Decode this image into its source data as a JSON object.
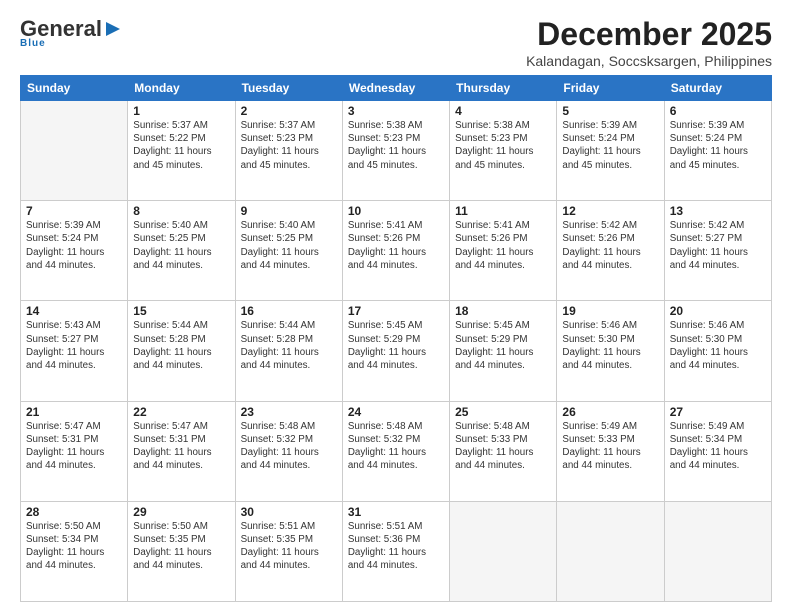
{
  "header": {
    "logo_general": "General",
    "logo_blue": "Blue",
    "month": "December 2025",
    "location": "Kalandagan, Soccsksargen, Philippines"
  },
  "days_of_week": [
    "Sunday",
    "Monday",
    "Tuesday",
    "Wednesday",
    "Thursday",
    "Friday",
    "Saturday"
  ],
  "weeks": [
    [
      {
        "day": "",
        "sunrise": "",
        "sunset": "",
        "daylight": ""
      },
      {
        "day": "1",
        "sunrise": "Sunrise: 5:37 AM",
        "sunset": "Sunset: 5:22 PM",
        "daylight": "Daylight: 11 hours and 45 minutes."
      },
      {
        "day": "2",
        "sunrise": "Sunrise: 5:37 AM",
        "sunset": "Sunset: 5:23 PM",
        "daylight": "Daylight: 11 hours and 45 minutes."
      },
      {
        "day": "3",
        "sunrise": "Sunrise: 5:38 AM",
        "sunset": "Sunset: 5:23 PM",
        "daylight": "Daylight: 11 hours and 45 minutes."
      },
      {
        "day": "4",
        "sunrise": "Sunrise: 5:38 AM",
        "sunset": "Sunset: 5:23 PM",
        "daylight": "Daylight: 11 hours and 45 minutes."
      },
      {
        "day": "5",
        "sunrise": "Sunrise: 5:39 AM",
        "sunset": "Sunset: 5:24 PM",
        "daylight": "Daylight: 11 hours and 45 minutes."
      },
      {
        "day": "6",
        "sunrise": "Sunrise: 5:39 AM",
        "sunset": "Sunset: 5:24 PM",
        "daylight": "Daylight: 11 hours and 45 minutes."
      }
    ],
    [
      {
        "day": "7",
        "sunrise": "Sunrise: 5:39 AM",
        "sunset": "Sunset: 5:24 PM",
        "daylight": "Daylight: 11 hours and 44 minutes."
      },
      {
        "day": "8",
        "sunrise": "Sunrise: 5:40 AM",
        "sunset": "Sunset: 5:25 PM",
        "daylight": "Daylight: 11 hours and 44 minutes."
      },
      {
        "day": "9",
        "sunrise": "Sunrise: 5:40 AM",
        "sunset": "Sunset: 5:25 PM",
        "daylight": "Daylight: 11 hours and 44 minutes."
      },
      {
        "day": "10",
        "sunrise": "Sunrise: 5:41 AM",
        "sunset": "Sunset: 5:26 PM",
        "daylight": "Daylight: 11 hours and 44 minutes."
      },
      {
        "day": "11",
        "sunrise": "Sunrise: 5:41 AM",
        "sunset": "Sunset: 5:26 PM",
        "daylight": "Daylight: 11 hours and 44 minutes."
      },
      {
        "day": "12",
        "sunrise": "Sunrise: 5:42 AM",
        "sunset": "Sunset: 5:26 PM",
        "daylight": "Daylight: 11 hours and 44 minutes."
      },
      {
        "day": "13",
        "sunrise": "Sunrise: 5:42 AM",
        "sunset": "Sunset: 5:27 PM",
        "daylight": "Daylight: 11 hours and 44 minutes."
      }
    ],
    [
      {
        "day": "14",
        "sunrise": "Sunrise: 5:43 AM",
        "sunset": "Sunset: 5:27 PM",
        "daylight": "Daylight: 11 hours and 44 minutes."
      },
      {
        "day": "15",
        "sunrise": "Sunrise: 5:44 AM",
        "sunset": "Sunset: 5:28 PM",
        "daylight": "Daylight: 11 hours and 44 minutes."
      },
      {
        "day": "16",
        "sunrise": "Sunrise: 5:44 AM",
        "sunset": "Sunset: 5:28 PM",
        "daylight": "Daylight: 11 hours and 44 minutes."
      },
      {
        "day": "17",
        "sunrise": "Sunrise: 5:45 AM",
        "sunset": "Sunset: 5:29 PM",
        "daylight": "Daylight: 11 hours and 44 minutes."
      },
      {
        "day": "18",
        "sunrise": "Sunrise: 5:45 AM",
        "sunset": "Sunset: 5:29 PM",
        "daylight": "Daylight: 11 hours and 44 minutes."
      },
      {
        "day": "19",
        "sunrise": "Sunrise: 5:46 AM",
        "sunset": "Sunset: 5:30 PM",
        "daylight": "Daylight: 11 hours and 44 minutes."
      },
      {
        "day": "20",
        "sunrise": "Sunrise: 5:46 AM",
        "sunset": "Sunset: 5:30 PM",
        "daylight": "Daylight: 11 hours and 44 minutes."
      }
    ],
    [
      {
        "day": "21",
        "sunrise": "Sunrise: 5:47 AM",
        "sunset": "Sunset: 5:31 PM",
        "daylight": "Daylight: 11 hours and 44 minutes."
      },
      {
        "day": "22",
        "sunrise": "Sunrise: 5:47 AM",
        "sunset": "Sunset: 5:31 PM",
        "daylight": "Daylight: 11 hours and 44 minutes."
      },
      {
        "day": "23",
        "sunrise": "Sunrise: 5:48 AM",
        "sunset": "Sunset: 5:32 PM",
        "daylight": "Daylight: 11 hours and 44 minutes."
      },
      {
        "day": "24",
        "sunrise": "Sunrise: 5:48 AM",
        "sunset": "Sunset: 5:32 PM",
        "daylight": "Daylight: 11 hours and 44 minutes."
      },
      {
        "day": "25",
        "sunrise": "Sunrise: 5:48 AM",
        "sunset": "Sunset: 5:33 PM",
        "daylight": "Daylight: 11 hours and 44 minutes."
      },
      {
        "day": "26",
        "sunrise": "Sunrise: 5:49 AM",
        "sunset": "Sunset: 5:33 PM",
        "daylight": "Daylight: 11 hours and 44 minutes."
      },
      {
        "day": "27",
        "sunrise": "Sunrise: 5:49 AM",
        "sunset": "Sunset: 5:34 PM",
        "daylight": "Daylight: 11 hours and 44 minutes."
      }
    ],
    [
      {
        "day": "28",
        "sunrise": "Sunrise: 5:50 AM",
        "sunset": "Sunset: 5:34 PM",
        "daylight": "Daylight: 11 hours and 44 minutes."
      },
      {
        "day": "29",
        "sunrise": "Sunrise: 5:50 AM",
        "sunset": "Sunset: 5:35 PM",
        "daylight": "Daylight: 11 hours and 44 minutes."
      },
      {
        "day": "30",
        "sunrise": "Sunrise: 5:51 AM",
        "sunset": "Sunset: 5:35 PM",
        "daylight": "Daylight: 11 hours and 44 minutes."
      },
      {
        "day": "31",
        "sunrise": "Sunrise: 5:51 AM",
        "sunset": "Sunset: 5:36 PM",
        "daylight": "Daylight: 11 hours and 44 minutes."
      },
      {
        "day": "",
        "sunrise": "",
        "sunset": "",
        "daylight": ""
      },
      {
        "day": "",
        "sunrise": "",
        "sunset": "",
        "daylight": ""
      },
      {
        "day": "",
        "sunrise": "",
        "sunset": "",
        "daylight": ""
      }
    ]
  ]
}
